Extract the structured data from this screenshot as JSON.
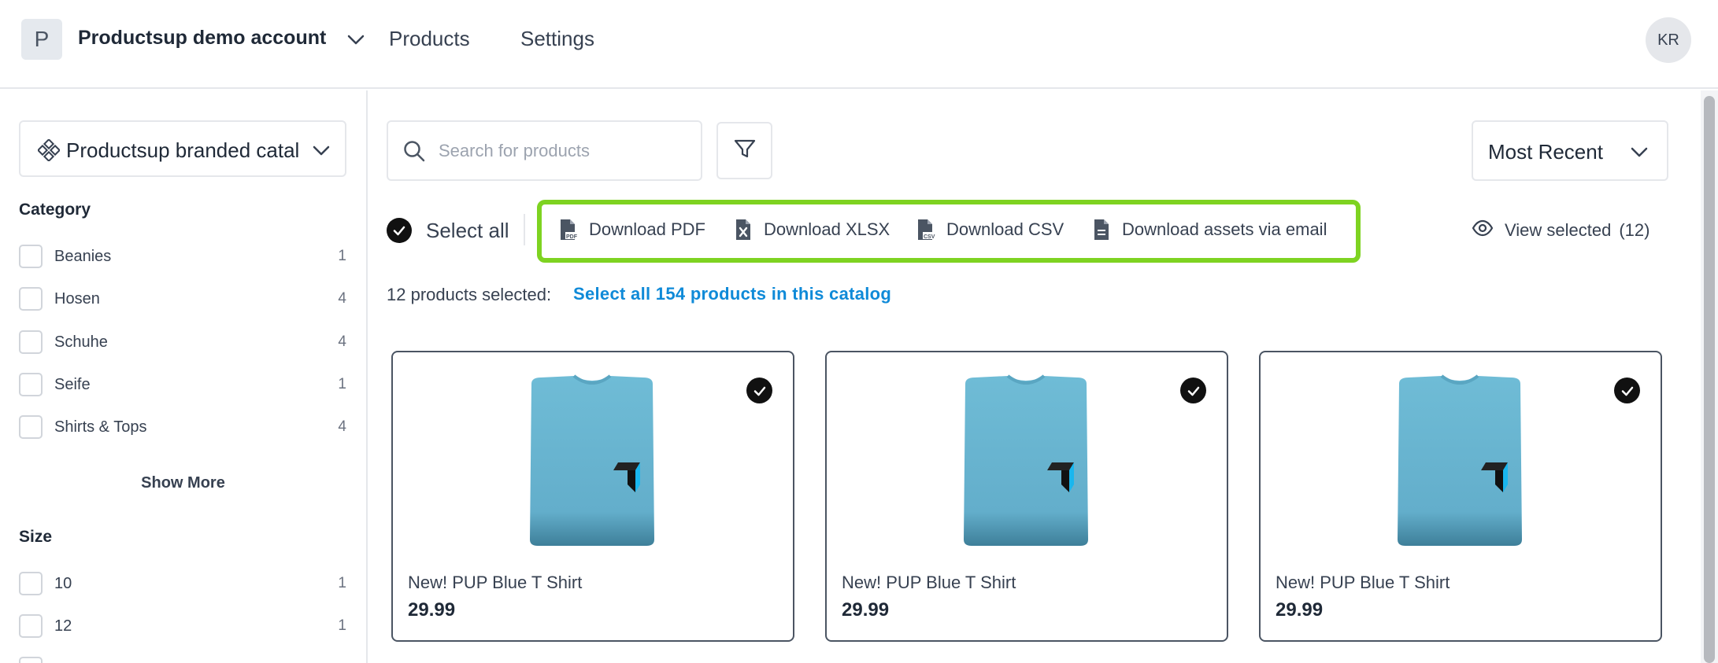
{
  "header": {
    "account_initial": "P",
    "account_name": "Productsup demo account",
    "nav": [
      {
        "label": "Products"
      },
      {
        "label": "Settings"
      }
    ],
    "user_initials": "KR"
  },
  "sidebar": {
    "catalog_label": "Productsup branded catal",
    "facets": [
      {
        "title": "Category",
        "items": [
          {
            "label": "Beanies",
            "count": "1"
          },
          {
            "label": "Hosen",
            "count": "4"
          },
          {
            "label": "Schuhe",
            "count": "4"
          },
          {
            "label": "Seife",
            "count": "1"
          },
          {
            "label": "Shirts & Tops",
            "count": "4"
          }
        ],
        "show_more": "Show More"
      },
      {
        "title": "Size",
        "items": [
          {
            "label": "10",
            "count": "1"
          },
          {
            "label": "12",
            "count": "1"
          }
        ]
      }
    ]
  },
  "toolbar": {
    "search_placeholder": "Search for products",
    "sort_label": "Most Recent",
    "select_all_label": "Select all",
    "actions": [
      {
        "label": "Download PDF",
        "icon": "pdf-file-icon"
      },
      {
        "label": "Download XLSX",
        "icon": "xlsx-file-icon"
      },
      {
        "label": "Download CSV",
        "icon": "csv-file-icon"
      },
      {
        "label": "Download assets via email",
        "icon": "document-icon"
      }
    ],
    "view_selected_label": "View selected",
    "view_selected_count": "(12)",
    "action_bar_highlight_color": "#7ed321"
  },
  "selection": {
    "count_text": "12 products selected:",
    "select_all_link": "Select all 154 products in this catalog"
  },
  "products": [
    {
      "name": "New! PUP Blue T Shirt",
      "price": "29.99",
      "selected": true
    },
    {
      "name": "New! PUP Blue T Shirt",
      "price": "29.99",
      "selected": true
    },
    {
      "name": "New! PUP Blue T Shirt",
      "price": "29.99",
      "selected": true
    }
  ],
  "colors": {
    "link": "#0f8ad8",
    "tshirt": "#6fbcd6"
  }
}
